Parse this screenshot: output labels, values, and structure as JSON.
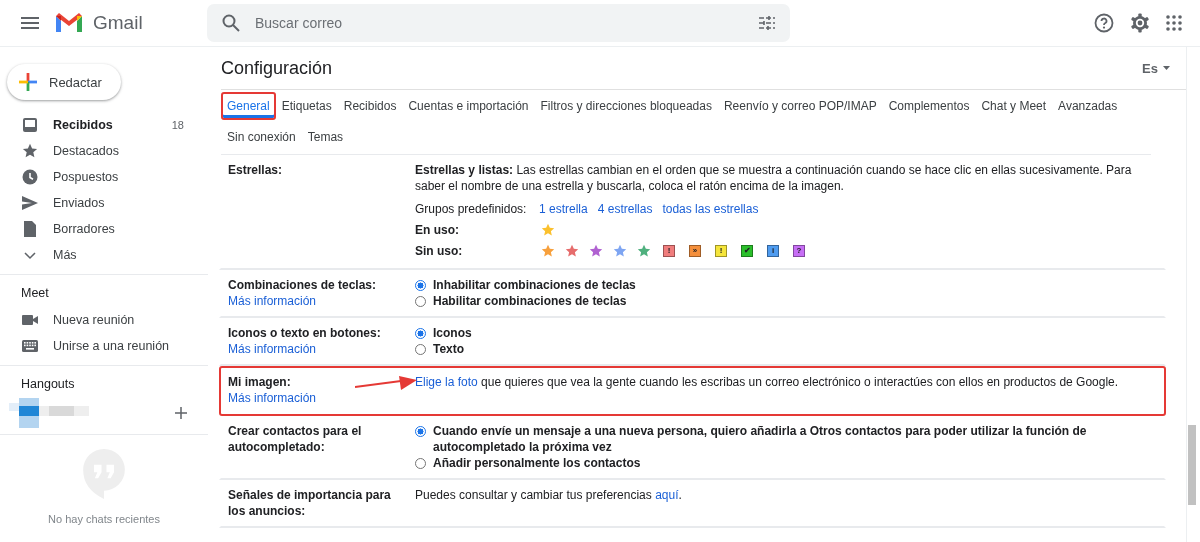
{
  "header": {
    "brand": "Gmail",
    "search": {
      "placeholder": "Buscar correo"
    }
  },
  "sidebar": {
    "compose": "Redactar",
    "items": [
      {
        "label": "Recibidos",
        "count": "18",
        "bold": true
      },
      {
        "label": "Destacados",
        "bold": false
      },
      {
        "label": "Pospuestos",
        "bold": false
      },
      {
        "label": "Enviados",
        "bold": false
      },
      {
        "label": "Borradores",
        "bold": false
      },
      {
        "label": "Más",
        "bold": false
      }
    ],
    "meet": {
      "title": "Meet",
      "items": [
        {
          "label": "Nueva reunión"
        },
        {
          "label": "Unirse a una reunión"
        }
      ]
    },
    "hangouts": {
      "title": "Hangouts",
      "empty": "No hay chats recientes"
    }
  },
  "settings": {
    "title": "Configuración",
    "language": "Es",
    "tabs": [
      {
        "label": "General",
        "selected": true,
        "highlighted": true
      },
      {
        "label": "Etiquetas",
        "selected": false,
        "highlighted": false
      },
      {
        "label": "Recibidos",
        "selected": false,
        "highlighted": false
      },
      {
        "label": "Cuentas e importación",
        "selected": false,
        "highlighted": false
      },
      {
        "label": "Filtros y direcciones bloqueadas",
        "selected": false,
        "highlighted": false
      },
      {
        "label": "Reenvío y correo POP/IMAP",
        "selected": false,
        "highlighted": false
      },
      {
        "label": "Complementos",
        "selected": false,
        "highlighted": false
      },
      {
        "label": "Chat y Meet",
        "selected": false,
        "highlighted": false
      },
      {
        "label": "Avanzadas",
        "selected": false,
        "highlighted": false
      },
      {
        "label": "Sin conexión",
        "selected": false,
        "highlighted": false
      },
      {
        "label": "Temas",
        "selected": false,
        "highlighted": false
      }
    ],
    "rows": [
      {
        "kind": "stars",
        "label": "Estrellas:",
        "highlighted": false,
        "description": "**Estrellas y listas:** Las estrellas cambian en el orden que se muestra a continuación cuando se hace clic en ellas sucesivamente. Para saber el nombre de una estrella y buscarla, coloca el ratón encima de la imagen.",
        "presets_label": "Grupos predefinidos:",
        "presets": [
          "1 estrella",
          "4 estrellas",
          "todas las estrellas"
        ],
        "in_use_label": "En uso:",
        "in_use": [
          {
            "kind": "star",
            "color": "#fbc02d"
          }
        ],
        "unused_label": "Sin uso:",
        "unused": [
          {
            "kind": "star",
            "color": "#f7a03c"
          },
          {
            "kind": "star",
            "color": "#e66c6c"
          },
          {
            "kind": "star",
            "color": "#b061d1"
          },
          {
            "kind": "star",
            "color": "#7ea5f2"
          },
          {
            "kind": "star",
            "color": "#4fb07e"
          },
          {
            "kind": "box",
            "color": "#f07d7d",
            "symbol": "!"
          },
          {
            "kind": "box",
            "color": "#f48f3c",
            "symbol": "»"
          },
          {
            "kind": "box",
            "color": "#f5e53b",
            "symbol": "!"
          },
          {
            "kind": "box",
            "color": "#2bbf2b",
            "symbol": "✔"
          },
          {
            "kind": "box",
            "color": "#4f9cf0",
            "symbol": "i"
          },
          {
            "kind": "box",
            "color": "#c76ef5",
            "symbol": "?"
          }
        ]
      },
      {
        "kind": "radio",
        "label": "Combinaciones de teclas:",
        "link": "Más información",
        "highlighted": false,
        "options": [
          {
            "label": "Inhabilitar combinaciones de teclas",
            "selected": true
          },
          {
            "label": "Habilitar combinaciones de teclas",
            "selected": false
          }
        ]
      },
      {
        "kind": "radio",
        "label": "Iconos o texto en botones:",
        "link": "Más información",
        "highlighted": false,
        "options": [
          {
            "label": "Iconos",
            "selected": true
          },
          {
            "label": "Texto",
            "selected": false
          }
        ]
      },
      {
        "kind": "text",
        "label": "Mi imagen:",
        "link": "Más información",
        "highlighted": true,
        "before": "",
        "inline_link": "Elige la foto",
        "after": " que quieres que vea la gente cuando les escribas un correo electrónico o interactúes con ellos en productos de Google."
      },
      {
        "kind": "radio",
        "label": "Crear contactos para el autocompletado:",
        "highlighted": false,
        "options": [
          {
            "label": "Cuando envíe un mensaje a una nueva persona, quiero añadirla a Otros contactos para poder utilizar la función de autocompletado la próxima vez",
            "selected": true
          },
          {
            "label": "Añadir personalmente los contactos",
            "selected": false
          }
        ]
      },
      {
        "kind": "text",
        "label": "Señales de importancia para los anuncios:",
        "highlighted": false,
        "before": "Puedes consultar y cambiar tus preferencias ",
        "inline_link": "aquí",
        "after": "."
      }
    ]
  }
}
